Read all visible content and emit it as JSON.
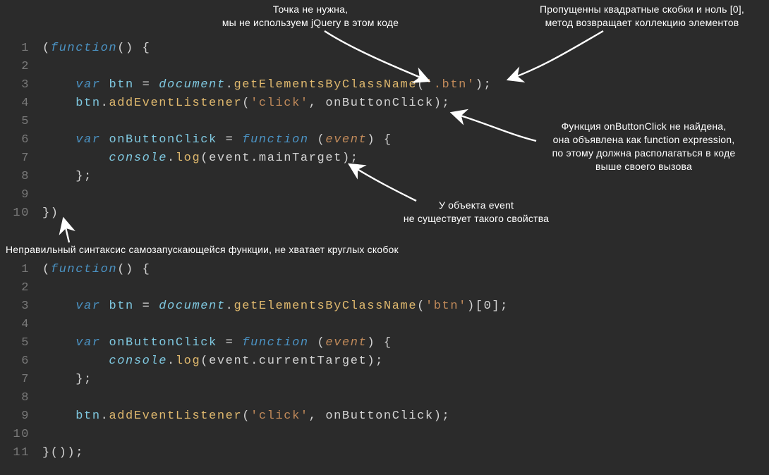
{
  "annotations": {
    "a1_l1": "Точка не нужна,",
    "a1_l2": "мы не используем jQuery в этом коде",
    "a2_l1": "Пропущенны квадратные скобки и ноль [0],",
    "a2_l2": "метод возвращает коллекцию элементов",
    "a3_l1": "Функция onButtonClick не найдена,",
    "a3_l2": "она объявлена как function expression,",
    "a3_l3": "по этому должна располагаться в коде",
    "a3_l4": "выше своего вызова",
    "a4_l1": "У объекта event",
    "a4_l2": "не существует такого свойства",
    "a5": "Неправильный синтаксис самозапускающейся функции, не хватает круглых скобок"
  },
  "code1": {
    "ln": [
      "1",
      "2",
      "3",
      "4",
      "5",
      "6",
      "7",
      "8",
      "9",
      "10"
    ],
    "l1": {
      "p0": "(",
      "kw": "function",
      "p1": "() {"
    },
    "l3": {
      "kw": "var",
      "v": "btn",
      "eq": " = ",
      "obj": "document",
      "dot": ".",
      "fn": "getElementsByClassName",
      "p0": "(",
      "s": "'.btn'",
      "p1": ");"
    },
    "l4": {
      "v": "btn",
      "dot": ".",
      "fn": "addEventListener",
      "p0": "(",
      "s": "'click'",
      "c": ", ",
      "a": "onButtonClick",
      "p1": ");"
    },
    "l6": {
      "kw": "var",
      "v": "onButtonClick",
      "eq": " = ",
      "kw2": "function",
      "sp": " ",
      "p0": "(",
      "pr": "event",
      "p1": ") {"
    },
    "l7": {
      "obj": "console",
      "dot": ".",
      "fn": "log",
      "p0": "(",
      "a": "event",
      "dot2": ".",
      "prop": "mainTarget",
      "p1": ");"
    },
    "l8": {
      "p": "};"
    },
    "l10": {
      "p": "})"
    }
  },
  "code2": {
    "ln": [
      "1",
      "2",
      "3",
      "4",
      "5",
      "6",
      "7",
      "8",
      "9",
      "10",
      "11"
    ],
    "l1": {
      "p0": "(",
      "kw": "function",
      "p1": "() {"
    },
    "l3": {
      "kw": "var",
      "v": "btn",
      "eq": " = ",
      "obj": "document",
      "dot": ".",
      "fn": "getElementsByClassName",
      "p0": "(",
      "s": "'btn'",
      "p1": ")[",
      "n": "0",
      "p2": "];"
    },
    "l5": {
      "kw": "var",
      "v": "onButtonClick",
      "eq": " = ",
      "kw2": "function",
      "sp": " ",
      "p0": "(",
      "pr": "event",
      "p1": ") {"
    },
    "l6": {
      "obj": "console",
      "dot": ".",
      "fn": "log",
      "p0": "(",
      "a": "event",
      "dot2": ".",
      "prop": "currentTarget",
      "p1": ");"
    },
    "l7": {
      "p": "};"
    },
    "l9": {
      "v": "btn",
      "dot": ".",
      "fn": "addEventListener",
      "p0": "(",
      "s": "'click'",
      "c": ", ",
      "a": "onButtonClick",
      "p1": ");"
    },
    "l11": {
      "p": "}());"
    }
  }
}
